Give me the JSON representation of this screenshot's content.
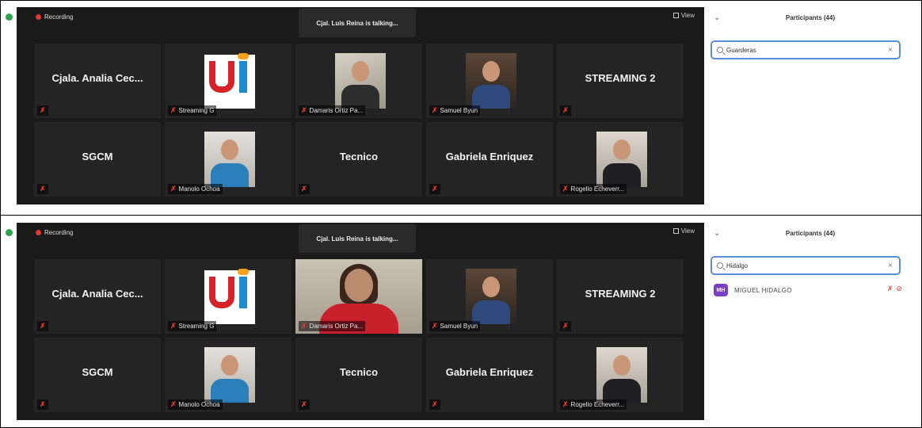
{
  "panels": [
    {
      "recording_label": "Recording",
      "talking_label": "Cjal. Luis Reina is talking...",
      "view_label": "View",
      "tiles": [
        {
          "kind": "name",
          "name": "Cjala. Analia Cec...",
          "label": ""
        },
        {
          "kind": "logo",
          "name": "",
          "label": "Streaming G"
        },
        {
          "kind": "photo",
          "name": "",
          "label": "Damaris Ortiz Pa..."
        },
        {
          "kind": "photo",
          "name": "",
          "label": "Samuel Byun"
        },
        {
          "kind": "name",
          "name": "STREAMING 2",
          "label": ""
        },
        {
          "kind": "name",
          "name": "SGCM",
          "label": ""
        },
        {
          "kind": "photo",
          "name": "",
          "label": "Manolo Ochoa"
        },
        {
          "kind": "name",
          "name": "Tecnico",
          "label": ""
        },
        {
          "kind": "name",
          "name": "Gabriela Enriquez",
          "label": ""
        },
        {
          "kind": "photo",
          "name": "",
          "label": "Rogelio Echeverr..."
        }
      ],
      "participants": {
        "title": "Participants (44)",
        "search_value": "Guarderas",
        "results": []
      }
    },
    {
      "recording_label": "Recording",
      "talking_label": "Cjal. Luis Reina is talking...",
      "view_label": "View",
      "tiles": [
        {
          "kind": "name",
          "name": "Cjala. Analia Cec...",
          "label": ""
        },
        {
          "kind": "logo",
          "name": "",
          "label": "Streaming G"
        },
        {
          "kind": "photo-big",
          "name": "",
          "label": "Damaris Ortiz Pa..."
        },
        {
          "kind": "photo",
          "name": "",
          "label": "Samuel Byun"
        },
        {
          "kind": "name",
          "name": "STREAMING 2",
          "label": ""
        },
        {
          "kind": "name",
          "name": "SGCM",
          "label": ""
        },
        {
          "kind": "photo",
          "name": "",
          "label": "Manolo Ochoa"
        },
        {
          "kind": "name",
          "name": "Tecnico",
          "label": ""
        },
        {
          "kind": "name",
          "name": "Gabriela Enriquez",
          "label": ""
        },
        {
          "kind": "photo",
          "name": "",
          "label": "Rogelio Echeverr..."
        }
      ],
      "participants": {
        "title": "Participants (44)",
        "search_value": "Hidalgo",
        "results": [
          {
            "initials": "MH",
            "name": "MIGUEL HIDALGO",
            "avatar_color": "#7a3fc4"
          }
        ]
      }
    }
  ],
  "colors": {
    "meeting_bg": "#1a1a1a",
    "tile_bg": "#242424",
    "muted_red": "#e0392f",
    "search_border": "#5a8fd8"
  }
}
